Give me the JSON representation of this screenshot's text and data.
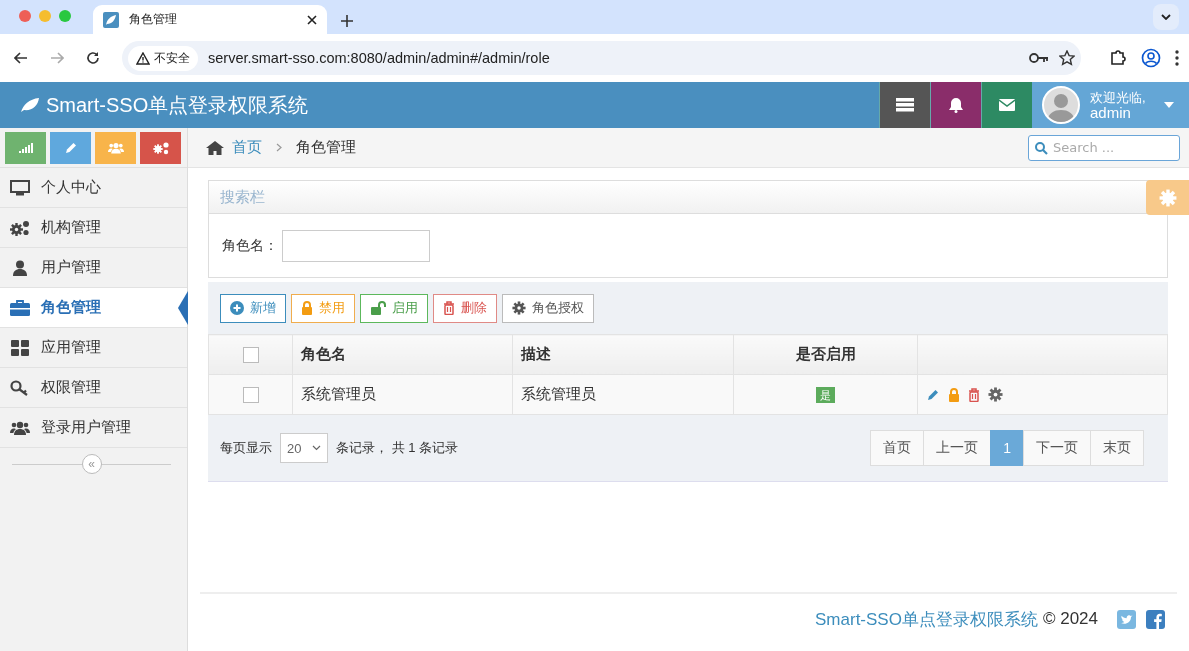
{
  "browser": {
    "tab_title": "角色管理",
    "security_label": "不安全",
    "url": "server.smart-sso.com:8080/admin/admin#/admin/role"
  },
  "header": {
    "title": "Smart-SSO单点登录权限系统",
    "greeting": "欢迎光临,",
    "username": "admin"
  },
  "sidebar": {
    "shortcuts": [
      {
        "kind": "stats",
        "color": "#6fb36f"
      },
      {
        "kind": "edit",
        "color": "#5fa8dd"
      },
      {
        "kind": "users",
        "color": "#f8b44a"
      },
      {
        "kind": "settings",
        "color": "#d6544a"
      }
    ],
    "items": [
      {
        "label": "个人中心",
        "kind": "monitor",
        "selected": false
      },
      {
        "label": "机构管理",
        "kind": "gears",
        "selected": false
      },
      {
        "label": "用户管理",
        "kind": "user",
        "selected": false
      },
      {
        "label": "角色管理",
        "kind": "briefcase",
        "selected": true
      },
      {
        "label": "应用管理",
        "kind": "grid",
        "selected": false
      },
      {
        "label": "权限管理",
        "kind": "key",
        "selected": false
      },
      {
        "label": "登录用户管理",
        "kind": "users",
        "selected": false
      }
    ],
    "collapse_symbol": "«"
  },
  "breadcrumb": {
    "home": "首页",
    "current": "角色管理"
  },
  "search": {
    "placeholder": "Search ..."
  },
  "filter_panel": {
    "title": "搜索栏",
    "field_label": "角色名："
  },
  "toolbar": {
    "buttons": [
      {
        "label": "新增",
        "kind": "add"
      },
      {
        "label": "禁用",
        "kind": "disable"
      },
      {
        "label": "启用",
        "kind": "enable"
      },
      {
        "label": "删除",
        "kind": "delete"
      },
      {
        "label": "角色授权",
        "kind": "authorize"
      }
    ]
  },
  "table": {
    "header_checked": false,
    "columns": [
      "角色名",
      "描述",
      "是否启用"
    ],
    "rows": [
      {
        "checked": false,
        "name": "系统管理员",
        "description": "系统管理员",
        "enabled": "是"
      }
    ]
  },
  "pagination": {
    "per_page_label": "每页显示",
    "page_size": "20",
    "summary": "条记录， 共 1 条记录",
    "pages": [
      {
        "label": "首页",
        "selected": false
      },
      {
        "label": "上一页",
        "selected": false
      },
      {
        "label": "1",
        "selected": true
      },
      {
        "label": "下一页",
        "selected": false
      },
      {
        "label": "末页",
        "selected": false
      }
    ]
  },
  "footer": {
    "brand": "Smart-SSO单点登录权限系统",
    "copyright": "© 2024"
  }
}
